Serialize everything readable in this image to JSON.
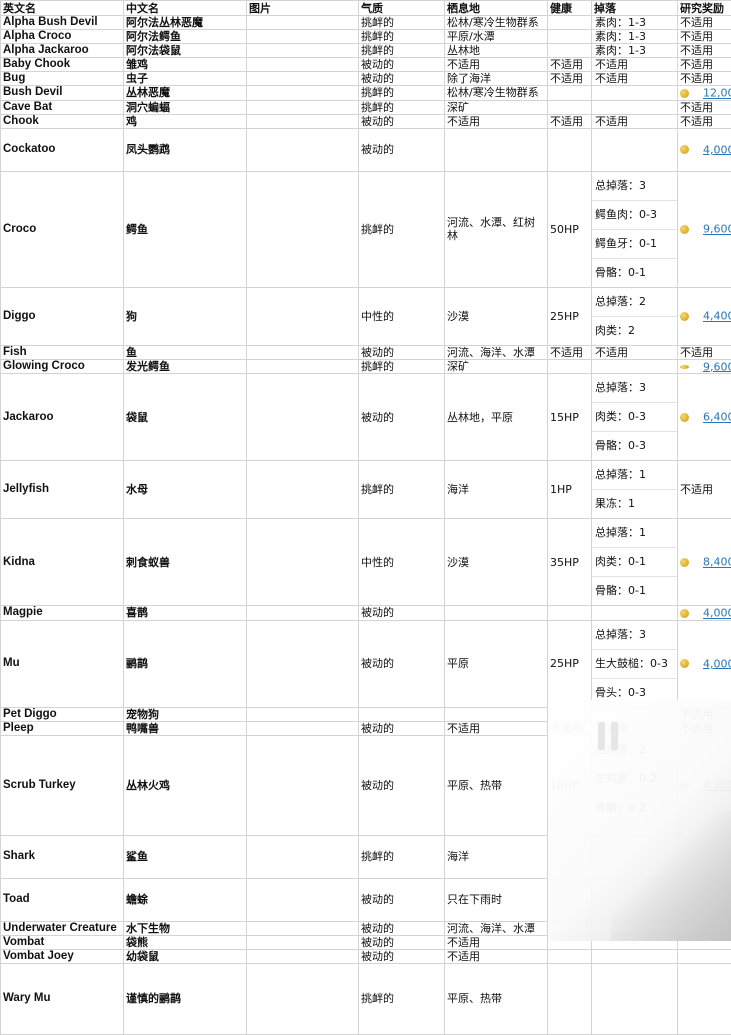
{
  "headers": [
    "英文名",
    "中文名",
    "图片",
    "气质",
    "栖息地",
    "健康",
    "掉落",
    "研究奖励"
  ],
  "rows": [
    {
      "en": "Alpha Bush Devil",
      "cn": "阿尔法丛林恶魔",
      "temper": "挑衅的",
      "habitat": "松林/寒冷生物群系",
      "health": "",
      "drops": [
        "素肉：1-3"
      ],
      "reward": "不适用"
    },
    {
      "en": "Alpha Croco",
      "cn": "阿尔法鳄鱼",
      "temper": "挑衅的",
      "habitat": "平原/水潭",
      "health": "",
      "drops": [
        "素肉：1-3"
      ],
      "reward": "不适用"
    },
    {
      "en": "Alpha Jackaroo",
      "cn": "阿尔法袋鼠",
      "temper": "挑衅的",
      "habitat": "丛林地",
      "health": "",
      "drops": [
        "素肉：1-3"
      ],
      "reward": "不适用"
    },
    {
      "en": "Baby Chook",
      "cn": "雏鸡",
      "temper": "被动的",
      "habitat": "不适用",
      "health": "不适用",
      "drops": [
        "不适用"
      ],
      "reward": "不适用"
    },
    {
      "en": "Bug",
      "cn": "虫子",
      "temper": "被动的",
      "habitat": "除了海洋",
      "health": "不适用",
      "drops": [
        "不适用"
      ],
      "reward": "不适用"
    },
    {
      "en": "Bush Devil",
      "cn": "丛林恶魔",
      "temper": "挑衅的",
      "habitat": "松林/寒冷生物群系",
      "health": "",
      "drops": [
        ""
      ],
      "reward": "12,000",
      "coin": true
    },
    {
      "en": "Cave Bat",
      "cn": "洞穴蝙蝠",
      "temper": "挑衅的",
      "habitat": "深矿",
      "health": "",
      "drops": [
        ""
      ],
      "reward": "不适用"
    },
    {
      "en": "Chook",
      "cn": "鸡",
      "temper": "被动的",
      "habitat": "不适用",
      "health": "不适用",
      "drops": [
        "不适用"
      ],
      "reward": "不适用"
    },
    {
      "en": "Cockatoo",
      "cn": "凤头鹦鹉",
      "temper": "被动的",
      "habitat": "",
      "health": "",
      "drops": [
        ""
      ],
      "reward": "4,000",
      "coin": true
    },
    {
      "en": "Croco",
      "cn": "鳄鱼",
      "temper": "挑衅的",
      "habitat": "河流、水潭、红树林",
      "health": "50HP",
      "drops": [
        "总掉落：3",
        "鳄鱼肉：0-3",
        "鳄鱼牙：0-1",
        "骨骼：0-1"
      ],
      "reward": "9,600",
      "coin": true
    },
    {
      "en": "Diggo",
      "cn": "狗",
      "temper": "中性的",
      "habitat": "沙漠",
      "health": "25HP",
      "drops": [
        "总掉落：2",
        "肉类：2"
      ],
      "reward": "4,400",
      "coin": true
    },
    {
      "en": "Fish",
      "cn": "鱼",
      "temper": "被动的",
      "habitat": "河流、海洋、水潭",
      "health": "不适用",
      "drops": [
        "不适用"
      ],
      "reward": "不适用"
    },
    {
      "en": "Glowing Croco",
      "cn": "发光鳄鱼",
      "temper": "挑衅的",
      "habitat": "深矿",
      "health": "",
      "drops": [
        ""
      ],
      "reward": "9,600",
      "coin": true,
      "flat": true
    },
    {
      "en": "Jackaroo",
      "cn": "袋鼠",
      "temper": "被动的",
      "habitat": "丛林地，平原",
      "health": "15HP",
      "drops": [
        "总掉落：3",
        "肉类：0-3",
        "骨骼：0-3"
      ],
      "reward": "6,400",
      "coin": true
    },
    {
      "en": "Jellyfish",
      "cn": "水母",
      "temper": "挑衅的",
      "habitat": "海洋",
      "health": "1HP",
      "drops": [
        "总掉落：1",
        "果冻：1"
      ],
      "reward": "不适用"
    },
    {
      "en": "Kidna",
      "cn": "刺食蚁兽",
      "temper": "中性的",
      "habitat": "沙漠",
      "health": "35HP",
      "drops": [
        "总掉落：1",
        "肉类：0-1",
        "骨骼：0-1"
      ],
      "reward": "8,400",
      "coin": true
    },
    {
      "en": "Magpie",
      "cn": "喜鹊",
      "temper": "被动的",
      "habitat": "",
      "health": "",
      "drops": [
        ""
      ],
      "reward": "4,000",
      "coin": true
    },
    {
      "en": "Mu",
      "cn": "鹂鹋",
      "temper": "被动的",
      "habitat": "平原",
      "health": "25HP",
      "drops": [
        "总掉落：3",
        "生大鼓槌：0-3",
        "骨头：0-3"
      ],
      "reward": "4,000",
      "coin": true
    },
    {
      "en": "Pet Diggo",
      "cn": "宠物狗",
      "temper": "",
      "habitat": "",
      "health": "",
      "drops": [
        ""
      ],
      "reward": "不适用"
    },
    {
      "en": "Pleep",
      "cn": "鸭嘴兽",
      "temper": "被动的",
      "habitat": "不适用",
      "health": "不适用",
      "drops": [
        "不适用"
      ],
      "reward": "不适用"
    },
    {
      "en": "Scrub Turkey",
      "cn": "丛林火鸡",
      "temper": "被动的",
      "habitat": "平原、热带",
      "health": "10HP",
      "drops": [
        "总掉落：2",
        "生鸡腿：0-2",
        "骨骼：0-2"
      ],
      "reward": "4,200",
      "coin": true
    },
    {
      "en": "Shark",
      "cn": "鲨鱼",
      "temper": "挑衅的",
      "habitat": "海洋",
      "health": "",
      "drops": [
        ""
      ],
      "reward": ""
    },
    {
      "en": "Toad",
      "cn": "蟾蜍",
      "temper": "被动的",
      "habitat": "只在下雨时",
      "health": "",
      "drops": [
        ""
      ],
      "reward": ""
    },
    {
      "en": "Underwater Creature",
      "cn": "水下生物",
      "temper": "被动的",
      "habitat": "河流、海洋、水潭",
      "health": "",
      "drops": [
        ""
      ],
      "reward": ""
    },
    {
      "en": "Vombat",
      "cn": "袋熊",
      "temper": "被动的",
      "habitat": "不适用",
      "health": "",
      "drops": [
        ""
      ],
      "reward": ""
    },
    {
      "en": "Vombat Joey",
      "cn": "幼袋鼠",
      "temper": "被动的",
      "habitat": "不适用",
      "health": "",
      "drops": [
        ""
      ],
      "reward": ""
    },
    {
      "en": "Wary Mu",
      "cn": "谨慎的鹂鹋",
      "temper": "挑衅的",
      "habitat": "平原、热带",
      "health": "",
      "drops": [
        ""
      ],
      "reward": ""
    }
  ]
}
